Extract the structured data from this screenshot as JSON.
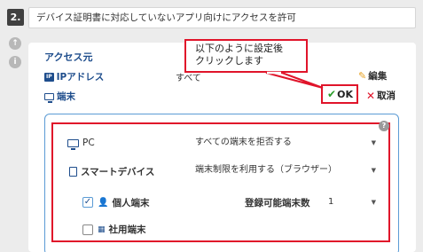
{
  "step": {
    "number": "2.",
    "title": "デバイス証明書に対応していないアプリ向けにアクセスを許可"
  },
  "side_icons": [
    "up-arrow-circle-icon",
    "info-circle-icon"
  ],
  "access": {
    "title": "アクセス元",
    "ip_label": "IPアドレス",
    "ip_icon_text": "IP",
    "ip_value": "すべて",
    "device_label": "端末",
    "edit_label": "編集",
    "ok_label": "OK",
    "cancel_label": "取消"
  },
  "callout": {
    "line1": "以下のように設定後",
    "line2": "クリックします"
  },
  "devices": {
    "pc_label": "PC",
    "pc_select": "すべての端末を拒否する",
    "smart_label": "スマートデバイス",
    "smart_select": "端末制限を利用する（ブラウザー）",
    "personal_label": "個人端末",
    "personal_checked": true,
    "register_label": "登録可能端末数",
    "register_value": "1",
    "company_label": "社用端末",
    "company_checked": false
  },
  "colors": {
    "accent": "#1e4d8c",
    "highlight": "#e0142a",
    "ok_check": "#2a9d2a",
    "box_border": "#5b9bd5"
  }
}
